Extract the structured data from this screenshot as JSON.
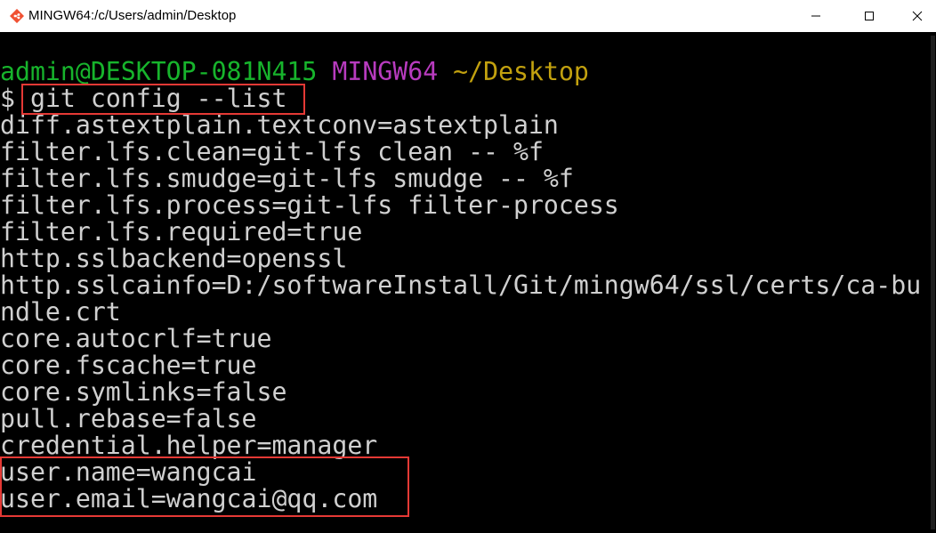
{
  "window": {
    "title": "MINGW64:/c/Users/admin/Desktop",
    "icon": "git-bash-icon",
    "controls": [
      "minimize-icon",
      "maximize-icon",
      "close-icon"
    ]
  },
  "terminal": {
    "prompt": {
      "user_host": "admin@DESKTOP-081N415",
      "system": "MINGW64",
      "cwd": "~/Desktop",
      "symbol": "$",
      "command": "git config --list"
    },
    "output": [
      "diff.astextplain.textconv=astextplain",
      "filter.lfs.clean=git-lfs clean -- %f",
      "filter.lfs.smudge=git-lfs smudge -- %f",
      "filter.lfs.process=git-lfs filter-process",
      "filter.lfs.required=true",
      "http.sslbackend=openssl",
      "http.sslcainfo=D:/softwareInstall/Git/mingw64/ssl/certs/ca-bu",
      "ndle.crt",
      "core.autocrlf=true",
      "core.fscache=true",
      "core.symlinks=false",
      "pull.rebase=false",
      "credential.helper=manager",
      "user.name=wangcai",
      "user.email=wangcai@qq.com"
    ]
  },
  "colors": {
    "user_host": "#17b42c",
    "system": "#b83bbf",
    "cwd": "#c2a10f",
    "text": "#d0d0d0",
    "highlight": "#e53935"
  }
}
